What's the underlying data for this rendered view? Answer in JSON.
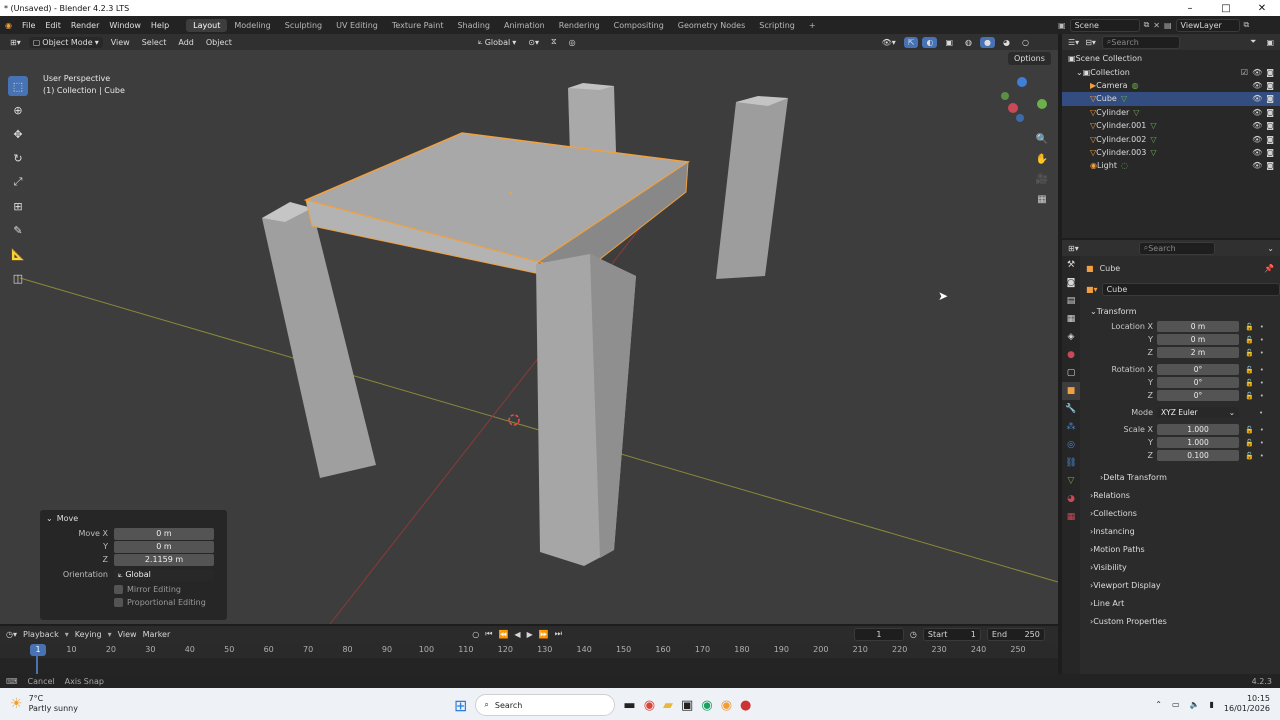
{
  "window": {
    "title": "* (Unsaved) - Blender 4.2.3 LTS"
  },
  "menu": {
    "items": [
      "File",
      "Edit",
      "Render",
      "Window",
      "Help"
    ],
    "workspaces": [
      "Layout",
      "Modeling",
      "Sculpting",
      "UV Editing",
      "Texture Paint",
      "Shading",
      "Animation",
      "Rendering",
      "Compositing",
      "Geometry Nodes",
      "Scripting"
    ],
    "active_workspace": "Layout",
    "scene": "Scene",
    "view_layer": "ViewLayer"
  },
  "viewport_header": {
    "mode": "Object Mode",
    "menus": [
      "View",
      "Select",
      "Add",
      "Object"
    ],
    "orientation": "Global",
    "options": "Options"
  },
  "viewport": {
    "perspective": "User Perspective",
    "collection_info": "(1) Collection | Cube"
  },
  "move_panel": {
    "title": "Move",
    "move_x_label": "Move X",
    "move_x": "0 m",
    "y_label": "Y",
    "y": "0 m",
    "z_label": "Z",
    "z": "2.1159 m",
    "orientation_label": "Orientation",
    "orientation": "Global",
    "mirror_editing": "Mirror Editing",
    "proportional_editing": "Proportional Editing"
  },
  "timeline": {
    "menus": [
      "Playback",
      "Keying",
      "View",
      "Marker"
    ],
    "current_frame": "1",
    "start_label": "Start",
    "start": "1",
    "end_label": "End",
    "end": "250",
    "ticks": [
      "1",
      "10",
      "20",
      "30",
      "40",
      "50",
      "60",
      "70",
      "80",
      "90",
      "100",
      "110",
      "120",
      "130",
      "140",
      "150",
      "160",
      "170",
      "180",
      "190",
      "200",
      "210",
      "220",
      "230",
      "240",
      "250"
    ]
  },
  "status": {
    "cancel": "Cancel",
    "axis_snap": "Axis Snap",
    "version": "4.2.3"
  },
  "outliner": {
    "search_placeholder": "Search",
    "root": "Scene Collection",
    "collection": "Collection",
    "items": [
      "Camera",
      "Cube",
      "Cylinder",
      "Cylinder.001",
      "Cylinder.002",
      "Cylinder.003",
      "Light"
    ],
    "selected": "Cube"
  },
  "properties": {
    "search_placeholder": "Search",
    "object_name": "Cube",
    "data_name": "Cube",
    "transform_title": "Transform",
    "location_label": "Location X",
    "location": [
      "0 m",
      "0 m",
      "2 m"
    ],
    "rotation_label": "Rotation X",
    "rotation": [
      "0°",
      "0°",
      "0°"
    ],
    "mode_label": "Mode",
    "mode": "XYZ Euler",
    "scale_label": "Scale X",
    "scale": [
      "1.000",
      "1.000",
      "0.100"
    ],
    "y_label": "Y",
    "z_label": "Z",
    "delta_transform": "Delta Transform",
    "panels": [
      "Relations",
      "Collections",
      "Instancing",
      "Motion Paths",
      "Visibility",
      "Viewport Display",
      "Line Art",
      "Custom Properties"
    ]
  },
  "taskbar": {
    "weather_temp": "7°C",
    "weather_desc": "Partly sunny",
    "search": "Search",
    "time": "10:15",
    "date": "16/01/2026"
  },
  "colors": {
    "accent": "#4772b3",
    "selection_outline": "#f0a040",
    "viewport_bg": "#3d3d3d"
  }
}
